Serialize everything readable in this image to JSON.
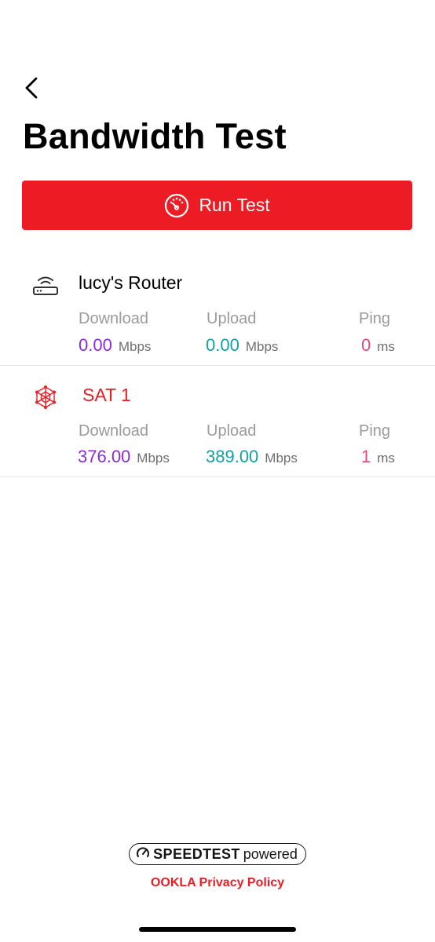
{
  "header": {
    "back_icon": "chevron-left-icon",
    "title": "Bandwidth Test"
  },
  "run_test": {
    "label": "Run Test",
    "icon": "speedometer-icon",
    "color": "#ED1C24"
  },
  "devices": [
    {
      "name": "lucy's Router",
      "icon": "router-icon",
      "name_color": "#000000",
      "download_label": "Download",
      "download_value": "0.00",
      "download_unit": "Mbps",
      "upload_label": "Upload",
      "upload_value": "0.00",
      "upload_unit": "Mbps",
      "ping_label": "Ping",
      "ping_value": "0",
      "ping_unit": "ms"
    },
    {
      "name": "SAT 1",
      "icon": "satellite-mesh-icon",
      "name_color": "#ED1C24",
      "download_label": "Download",
      "download_value": "376.00",
      "download_unit": "Mbps",
      "upload_label": "Upload",
      "upload_value": "389.00",
      "upload_unit": "Mbps",
      "ping_label": "Ping",
      "ping_value": "1",
      "ping_unit": "ms"
    }
  ],
  "colors": {
    "download": "#8A2BE2",
    "upload": "#12A1A1",
    "ping": "#E8457E",
    "accent": "#ED1C24"
  },
  "footer": {
    "speedtest_brand": "SPEEDTEST",
    "speedtest_powered": "powered",
    "speedtest_icon": "speedometer-icon",
    "privacy_link": "OOKLA Privacy Policy"
  }
}
